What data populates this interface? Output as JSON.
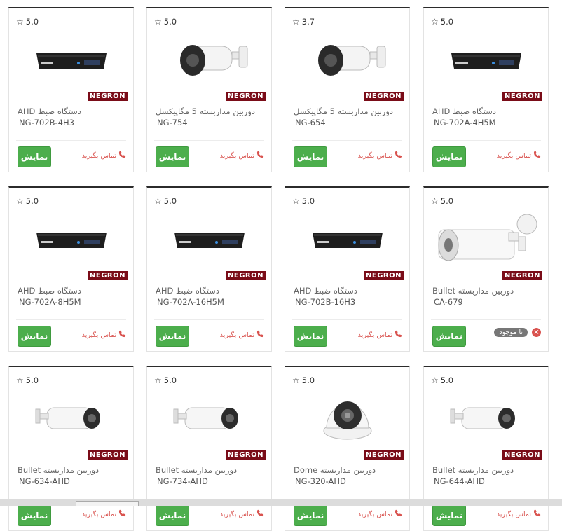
{
  "buttons": {
    "show_label": "نمایش"
  },
  "contact": {
    "label": "تماس بگیرید",
    "icon": "phone-icon"
  },
  "brand": {
    "name": "NEGRON",
    "color": "#7a0c18"
  },
  "colors": {
    "button": "#4cae4c",
    "contact": "#d9534f",
    "card_top_border": "#2b2b2b"
  },
  "products": [
    {
      "rating": "5.0",
      "name": "دستگاه ضبط AHD",
      "code": "NG-702A-4H5M",
      "image": "dvr",
      "status": "contact"
    },
    {
      "rating": "3.7",
      "name": "دوربین مداربسته 5 مگاپیکسل",
      "code": "NG-654",
      "image": "bullet-large",
      "status": "contact"
    },
    {
      "rating": "5.0",
      "name": "دوربین مداربسته 5 مگاپیکسل",
      "code": "NG-754",
      "image": "bullet-large",
      "status": "contact"
    },
    {
      "rating": "5.0",
      "name": "دستگاه ضبط AHD",
      "code": "NG-702B-4H3",
      "image": "dvr",
      "status": "contact"
    },
    {
      "rating": "5.0",
      "name": "دوربین مداربسته Bullet",
      "code": "CA-679",
      "image": "bullet-white",
      "status": "unavailable",
      "status_label": "نا موجود"
    },
    {
      "rating": "5.0",
      "name": "دستگاه ضبط AHD",
      "code": "NG-702B-16H3",
      "image": "dvr",
      "status": "contact"
    },
    {
      "rating": "5.0",
      "name": "دستگاه ضبط AHD",
      "code": "NG-702A-16H5M",
      "image": "dvr",
      "status": "contact"
    },
    {
      "rating": "5.0",
      "name": "دستگاه ضبط AHD",
      "code": "NG-702A-8H5M",
      "image": "dvr",
      "status": "contact"
    },
    {
      "rating": "5.0",
      "name": "دوربین مداربسته Bullet",
      "code": "NG-644-AHD",
      "image": "bullet-small",
      "status": "contact"
    },
    {
      "rating": "5.0",
      "name": "دوربین مداربسته Dome",
      "code": "NG-320-AHD",
      "image": "dome",
      "status": "contact"
    },
    {
      "rating": "5.0",
      "name": "دوربین مداربسته Bullet",
      "code": "NG-734-AHD",
      "image": "bullet-small",
      "status": "contact"
    },
    {
      "rating": "5.0",
      "name": "دوربین مداربسته Bullet",
      "code": "NG-634-AHD",
      "image": "bullet-small",
      "status": "contact"
    }
  ]
}
